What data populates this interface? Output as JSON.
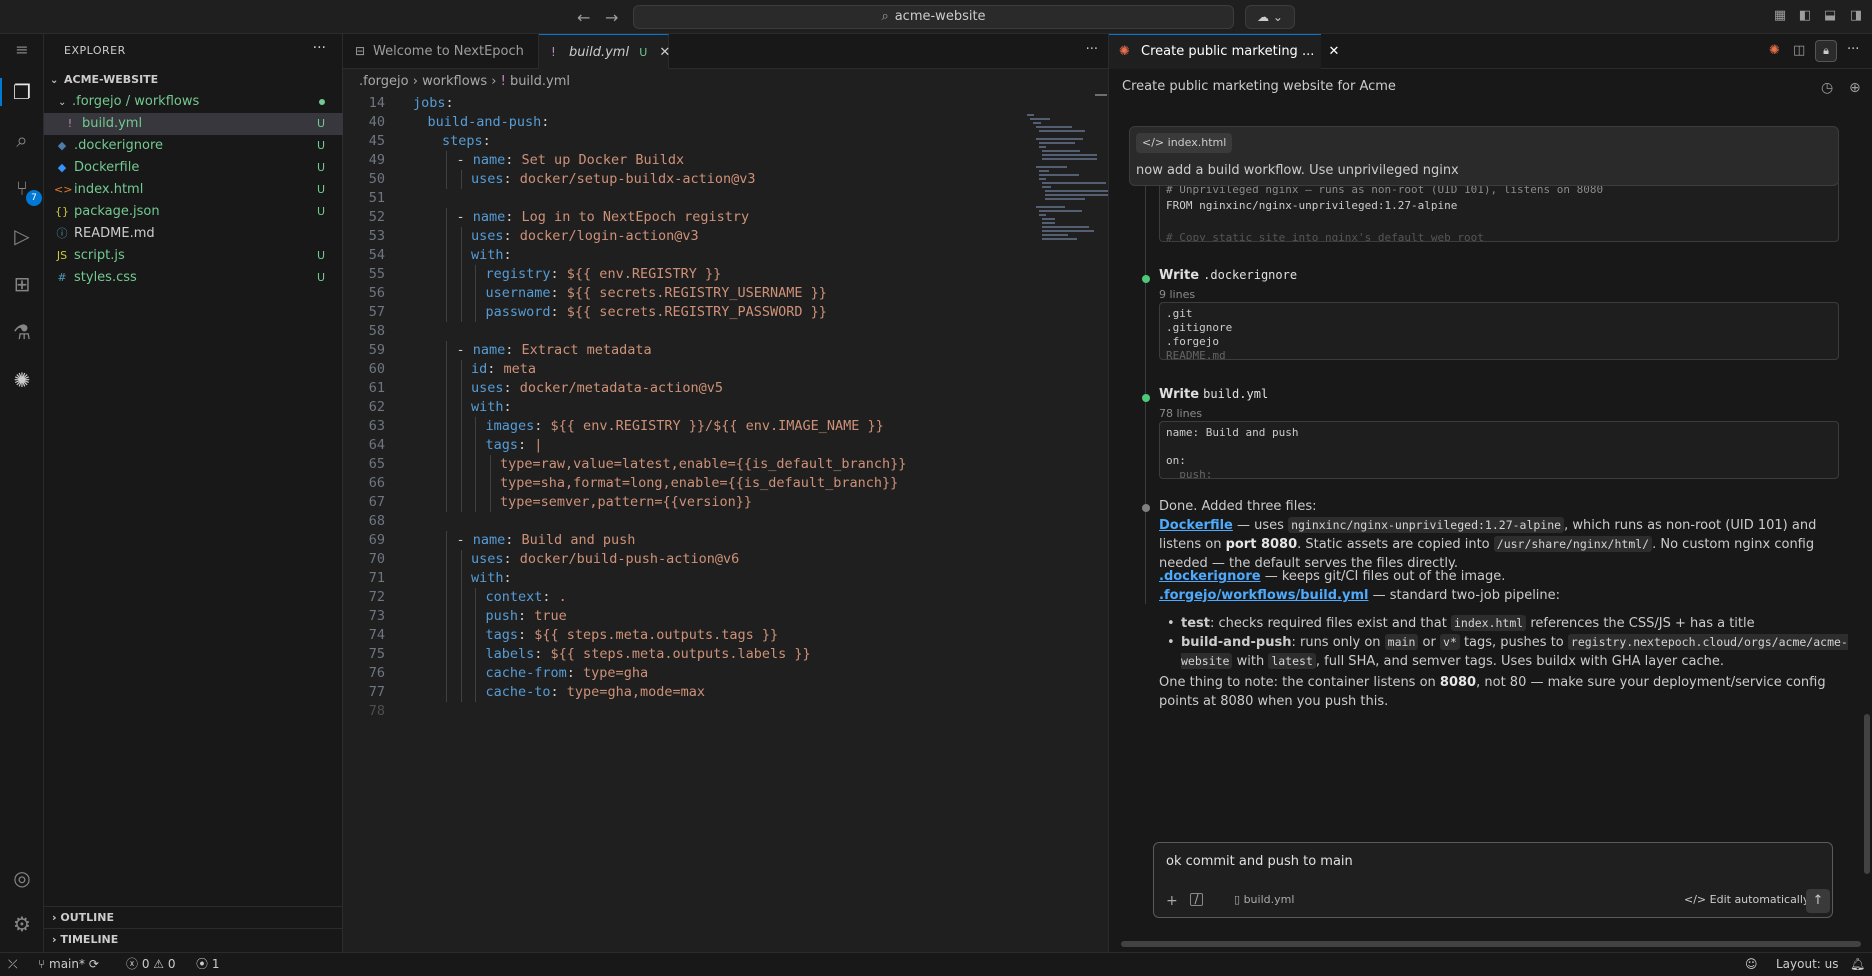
{
  "titlebar": {
    "search_text": "acme-website",
    "back_icon": "arrow-left-icon",
    "forward_icon": "arrow-right-icon"
  },
  "activity": {
    "source_control_badge": "7"
  },
  "explorer": {
    "title": "EXPLORER",
    "root": "ACME-WEBSITE",
    "items": [
      {
        "name": ".forgejo / workflows",
        "type": "folder",
        "status": "dot"
      },
      {
        "name": "build.yml",
        "type": "yaml",
        "status": "U"
      },
      {
        "name": ".dockerignore",
        "type": "docker",
        "status": "U"
      },
      {
        "name": "Dockerfile",
        "type": "docker",
        "status": "U"
      },
      {
        "name": "index.html",
        "type": "html",
        "status": "U"
      },
      {
        "name": "package.json",
        "type": "json",
        "status": "U"
      },
      {
        "name": "README.md",
        "type": "md",
        "status": ""
      },
      {
        "name": "script.js",
        "type": "js",
        "status": "U"
      },
      {
        "name": "styles.css",
        "type": "css",
        "status": "U"
      }
    ],
    "outline": "OUTLINE",
    "timeline": "TIMELINE"
  },
  "editor": {
    "tabs": [
      {
        "label": "Welcome to NextEpoch"
      },
      {
        "label": "build.yml",
        "status": "U"
      }
    ],
    "breadcrumb": [
      ".forgejo",
      "workflows",
      "build.yml"
    ],
    "lines": [
      {
        "n": "14",
        "t": "jobs:",
        "i": 0
      },
      {
        "n": "40",
        "t": "build-and-push:",
        "i": 1
      },
      {
        "n": "45",
        "t": "steps:",
        "i": 2
      },
      {
        "n": "49",
        "t": "- name: Set up Docker Buildx",
        "i": 3
      },
      {
        "n": "50",
        "t": "uses: docker/setup-buildx-action@v3",
        "i": 4
      },
      {
        "n": "51",
        "t": "",
        "i": 0
      },
      {
        "n": "52",
        "t": "- name: Log in to NextEpoch registry",
        "i": 3
      },
      {
        "n": "53",
        "t": "uses: docker/login-action@v3",
        "i": 4
      },
      {
        "n": "54",
        "t": "with:",
        "i": 4
      },
      {
        "n": "55",
        "t": "registry: ${{ env.REGISTRY }}",
        "i": 5
      },
      {
        "n": "56",
        "t": "username: ${{ secrets.REGISTRY_USERNAME }}",
        "i": 5
      },
      {
        "n": "57",
        "t": "password: ${{ secrets.REGISTRY_PASSWORD }}",
        "i": 5
      },
      {
        "n": "58",
        "t": "",
        "i": 0
      },
      {
        "n": "59",
        "t": "- name: Extract metadata",
        "i": 3
      },
      {
        "n": "60",
        "t": "id: meta",
        "i": 4
      },
      {
        "n": "61",
        "t": "uses: docker/metadata-action@v5",
        "i": 4
      },
      {
        "n": "62",
        "t": "with:",
        "i": 4
      },
      {
        "n": "63",
        "t": "images: ${{ env.REGISTRY }}/${{ env.IMAGE_NAME }}",
        "i": 5
      },
      {
        "n": "64",
        "t": "tags: |",
        "i": 5
      },
      {
        "n": "65",
        "t": "type=raw,value=latest,enable={{is_default_branch}}",
        "i": 6
      },
      {
        "n": "66",
        "t": "type=sha,format=long,enable={{is_default_branch}}",
        "i": 6
      },
      {
        "n": "67",
        "t": "type=semver,pattern={{version}}",
        "i": 6
      },
      {
        "n": "68",
        "t": "",
        "i": 0
      },
      {
        "n": "69",
        "t": "- name: Build and push",
        "i": 3
      },
      {
        "n": "70",
        "t": "uses: docker/build-push-action@v6",
        "i": 4
      },
      {
        "n": "71",
        "t": "with:",
        "i": 4
      },
      {
        "n": "72",
        "t": "context: .",
        "i": 5
      },
      {
        "n": "73",
        "t": "push: true",
        "i": 5
      },
      {
        "n": "74",
        "t": "tags: ${{ steps.meta.outputs.tags }}",
        "i": 5
      },
      {
        "n": "75",
        "t": "labels: ${{ steps.meta.outputs.labels }}",
        "i": 5
      },
      {
        "n": "76",
        "t": "cache-from: type=gha",
        "i": 5
      },
      {
        "n": "77",
        "t": "cache-to: type=gha,mode=max",
        "i": 5
      },
      {
        "n": "78",
        "t": "",
        "i": 0
      }
    ]
  },
  "chat": {
    "tab_label": "Create public marketing ...",
    "title": "Create public marketing website for Acme",
    "user_message": {
      "attachment": "index.html",
      "text": "now add a build workflow. Use unprivileged nginx"
    },
    "dockerfile_preview": [
      "# Unprivileged nginx — runs as non-root (UID 101), listens on 8080",
      "FROM nginxinc/nginx-unprivileged:1.27-alpine",
      "",
      "# Copy static site into nginx's default web root"
    ],
    "steps": [
      {
        "verb": "Write",
        "file": ".dockerignore",
        "sub": "9 lines",
        "preview": [
          ".git",
          ".gitignore",
          ".forgejo",
          "README.md"
        ]
      },
      {
        "verb": "Write",
        "file": "build.yml",
        "sub": "78 lines",
        "preview": [
          "name: Build and push",
          "",
          "on:",
          "  push:"
        ]
      }
    ],
    "summary": {
      "intro": "Done. Added three files:",
      "dockerfile_link": "Dockerfile",
      "dockerfile_text_1": " — uses ",
      "dockerfile_code_1": "nginxinc/nginx-unprivileged:1.27-alpine",
      "dockerfile_text_2": ", which runs as non-root (UID 101) and listens on ",
      "dockerfile_bold": "port 8080",
      "dockerfile_text_3": ". Static assets are copied into ",
      "dockerfile_code_2": "/usr/share/nginx/html/",
      "dockerfile_text_4": ". No custom nginx config needed — the default serves the files directly.",
      "dockerignore_link": ".dockerignore",
      "dockerignore_text": " — keeps git/CI files out of the image.",
      "build_link": ".forgejo/workflows/build.yml",
      "build_text": " — standard two-job pipeline:",
      "bullet1_bold": "test",
      "bullet1_text_1": ": checks required files exist and that ",
      "bullet1_code": "index.html",
      "bullet1_text_2": " references the CSS/JS + has a title",
      "bullet2_bold": "build-and-push",
      "bullet2_text_1": ": runs only on ",
      "bullet2_code_1": "main",
      "bullet2_text_2": " or ",
      "bullet2_code_2": "v*",
      "bullet2_text_3": " tags, pushes to ",
      "bullet2_code_3": "registry.nextepoch.cloud/orgs/acme/acme-website",
      "bullet2_text_4": " with ",
      "bullet2_code_4": "latest",
      "bullet2_text_5": ", full SHA, and semver tags. Uses buildx with GHA layer cache.",
      "note_1": "One thing to note: the container listens on ",
      "note_bold": "8080",
      "note_2": ", not 80 — make sure your deployment/service config points at 8080 when you push this."
    },
    "composer": {
      "value": "ok commit and push to main",
      "attachment": "build.yml",
      "mode": "Edit automatically"
    }
  },
  "status": {
    "branch": "main*",
    "errors": "0",
    "warnings": "0",
    "ports": "1",
    "layout": "Layout: us"
  }
}
